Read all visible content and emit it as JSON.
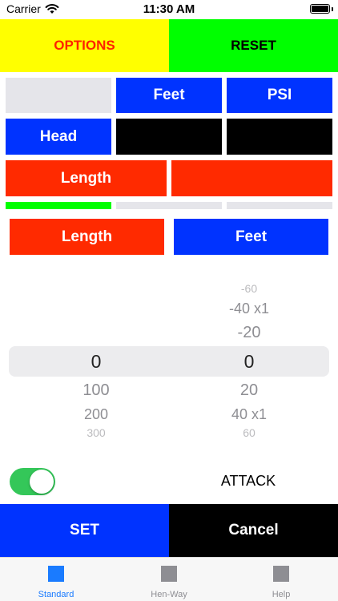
{
  "status": {
    "carrier": "Carrier",
    "time": "11:30 AM"
  },
  "top": {
    "options": "OPTIONS",
    "reset": "RESET"
  },
  "grid": {
    "row1": [
      "",
      "Feet",
      "PSI"
    ],
    "row2": [
      "Head",
      "",
      ""
    ],
    "row3": [
      "Length",
      ""
    ]
  },
  "units": {
    "left": "Length",
    "right": "Feet"
  },
  "picker_left": {
    "above": [
      "",
      "",
      ""
    ],
    "selected": "0",
    "below": [
      "100",
      "200",
      "300"
    ]
  },
  "picker_right": {
    "above": [
      "-60",
      "-40 x1",
      "-20"
    ],
    "selected": "0",
    "below": [
      "20",
      "40 x1",
      "60"
    ]
  },
  "toggle": {
    "on": true,
    "color": "#34c759"
  },
  "attack_label": "ATTACK",
  "actions": {
    "set": "SET",
    "cancel": "Cancel"
  },
  "tabs": [
    {
      "label": "Standard",
      "active": true
    },
    {
      "label": "Hen-Way",
      "active": false
    },
    {
      "label": "Help",
      "active": false
    }
  ],
  "colors": {
    "blue": "#0033ff",
    "red": "#ff2a00",
    "green": "#00ff00",
    "yellow": "#ffff00",
    "active_tab": "#1a7bff",
    "inactive_tab": "#8e8e93"
  }
}
